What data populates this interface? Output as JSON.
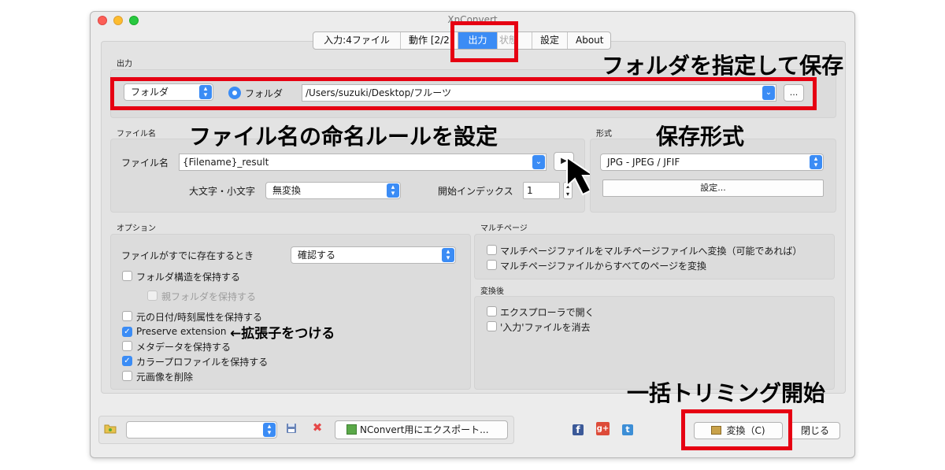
{
  "window": {
    "title": "XnConvert"
  },
  "colors": {
    "accent": "#3b8cf5",
    "highlight_red": "#e60012"
  },
  "tabs": [
    {
      "label": "入力:4ファイル",
      "state": "normal"
    },
    {
      "label": "動作 [2/2",
      "state": "normal"
    },
    {
      "label": "出力",
      "state": "active"
    },
    {
      "label": "状態",
      "state": "dim"
    },
    {
      "label": "設定",
      "state": "normal"
    },
    {
      "label": "About",
      "state": "normal"
    }
  ],
  "output": {
    "section_label": "出力",
    "dest_type": "フォルダ",
    "radio_label": "フォルダ",
    "path": "/Users/suzuki/Desktop/フルーツ",
    "browse_label": "..."
  },
  "filename": {
    "section_label": "ファイル名",
    "field_label": "ファイル名",
    "pattern": "{Filename}_result",
    "case_label": "大文字・小文字",
    "case_value": "無変換",
    "start_index_label": "開始インデックス",
    "start_index_value": "1"
  },
  "format": {
    "section_label": "形式",
    "value": "JPG - JPEG / JFIF",
    "settings_label": "設定..."
  },
  "options": {
    "section_label": "オプション",
    "exists_label": "ファイルがすでに存在するとき",
    "exists_value": "確認する",
    "items": [
      {
        "label": "フォルダ構造を保持する",
        "checked": false,
        "enabled": true
      },
      {
        "label": "親フォルダを保持する",
        "checked": false,
        "enabled": false
      },
      {
        "label": "元の日付/時刻属性を保持する",
        "checked": false,
        "enabled": true
      },
      {
        "label": "Preserve extension",
        "checked": true,
        "enabled": true
      },
      {
        "label": "メタデータを保持する",
        "checked": false,
        "enabled": true
      },
      {
        "label": "カラープロファイルを保持する",
        "checked": true,
        "enabled": true
      },
      {
        "label": "元画像を削除",
        "checked": false,
        "enabled": true
      }
    ]
  },
  "multipage": {
    "section_label": "マルチページ",
    "items": [
      {
        "label": "マルチページファイルをマルチページファイルへ変換（可能であれば）",
        "checked": false
      },
      {
        "label": "マルチページファイルからすべてのページを変換",
        "checked": false
      }
    ]
  },
  "after": {
    "section_label": "変換後",
    "items": [
      {
        "label": "エクスプローラで開く",
        "checked": false
      },
      {
        "label": "'入力'ファイルを消去",
        "checked": false
      }
    ]
  },
  "bottom": {
    "preset_value": "",
    "export_label": "NConvert用にエクスポート...",
    "convert_label": "変換（C)",
    "close_label": "閉じる",
    "social_icons": [
      "facebook-icon",
      "google-plus-icon",
      "twitter-icon"
    ]
  },
  "annotations": {
    "folder": "フォルダを指定して保存",
    "naming": "ファイル名の命名ルールを設定",
    "format": "保存形式",
    "extension": "←拡張子をつける",
    "batch": "一括トリミング開始"
  }
}
